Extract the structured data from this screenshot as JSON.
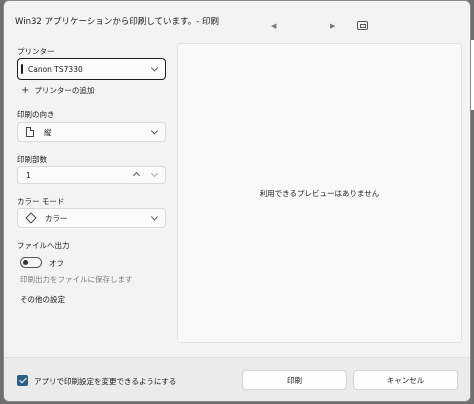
{
  "window": {
    "title": "Win32 アプリケーションから印刷しています。- 印刷"
  },
  "printer": {
    "label": "プリンター",
    "value": "Canon TS7330",
    "add_label": "プリンターの追加"
  },
  "orientation": {
    "label": "印刷の向き",
    "value": "縦"
  },
  "copies": {
    "label": "印刷部数",
    "value": "1"
  },
  "color_mode": {
    "label": "カラー モード",
    "value": "カラー"
  },
  "print_to_file": {
    "label": "ファイルへ出力",
    "toggle_label": "オフ",
    "hint": "印刷出力をファイルに保存します"
  },
  "more_settings": {
    "label": "その他の設定"
  },
  "preview": {
    "message": "利用できるプレビューはありません"
  },
  "footer": {
    "checkbox_label": "アプリで印刷設定を変更できるようにする",
    "print_button": "印刷",
    "cancel_button": "キャンセル"
  },
  "colors": {
    "accent": "#2b5f85",
    "dialog_bg": "#f3f3f3"
  },
  "icons": [
    "chevron-left-icon",
    "chevron-right-icon",
    "fit-page-icon",
    "plus-icon",
    "portrait-document-icon",
    "color-icon",
    "chevron-down-icon",
    "chevron-up-icon",
    "checkmark-icon"
  ]
}
